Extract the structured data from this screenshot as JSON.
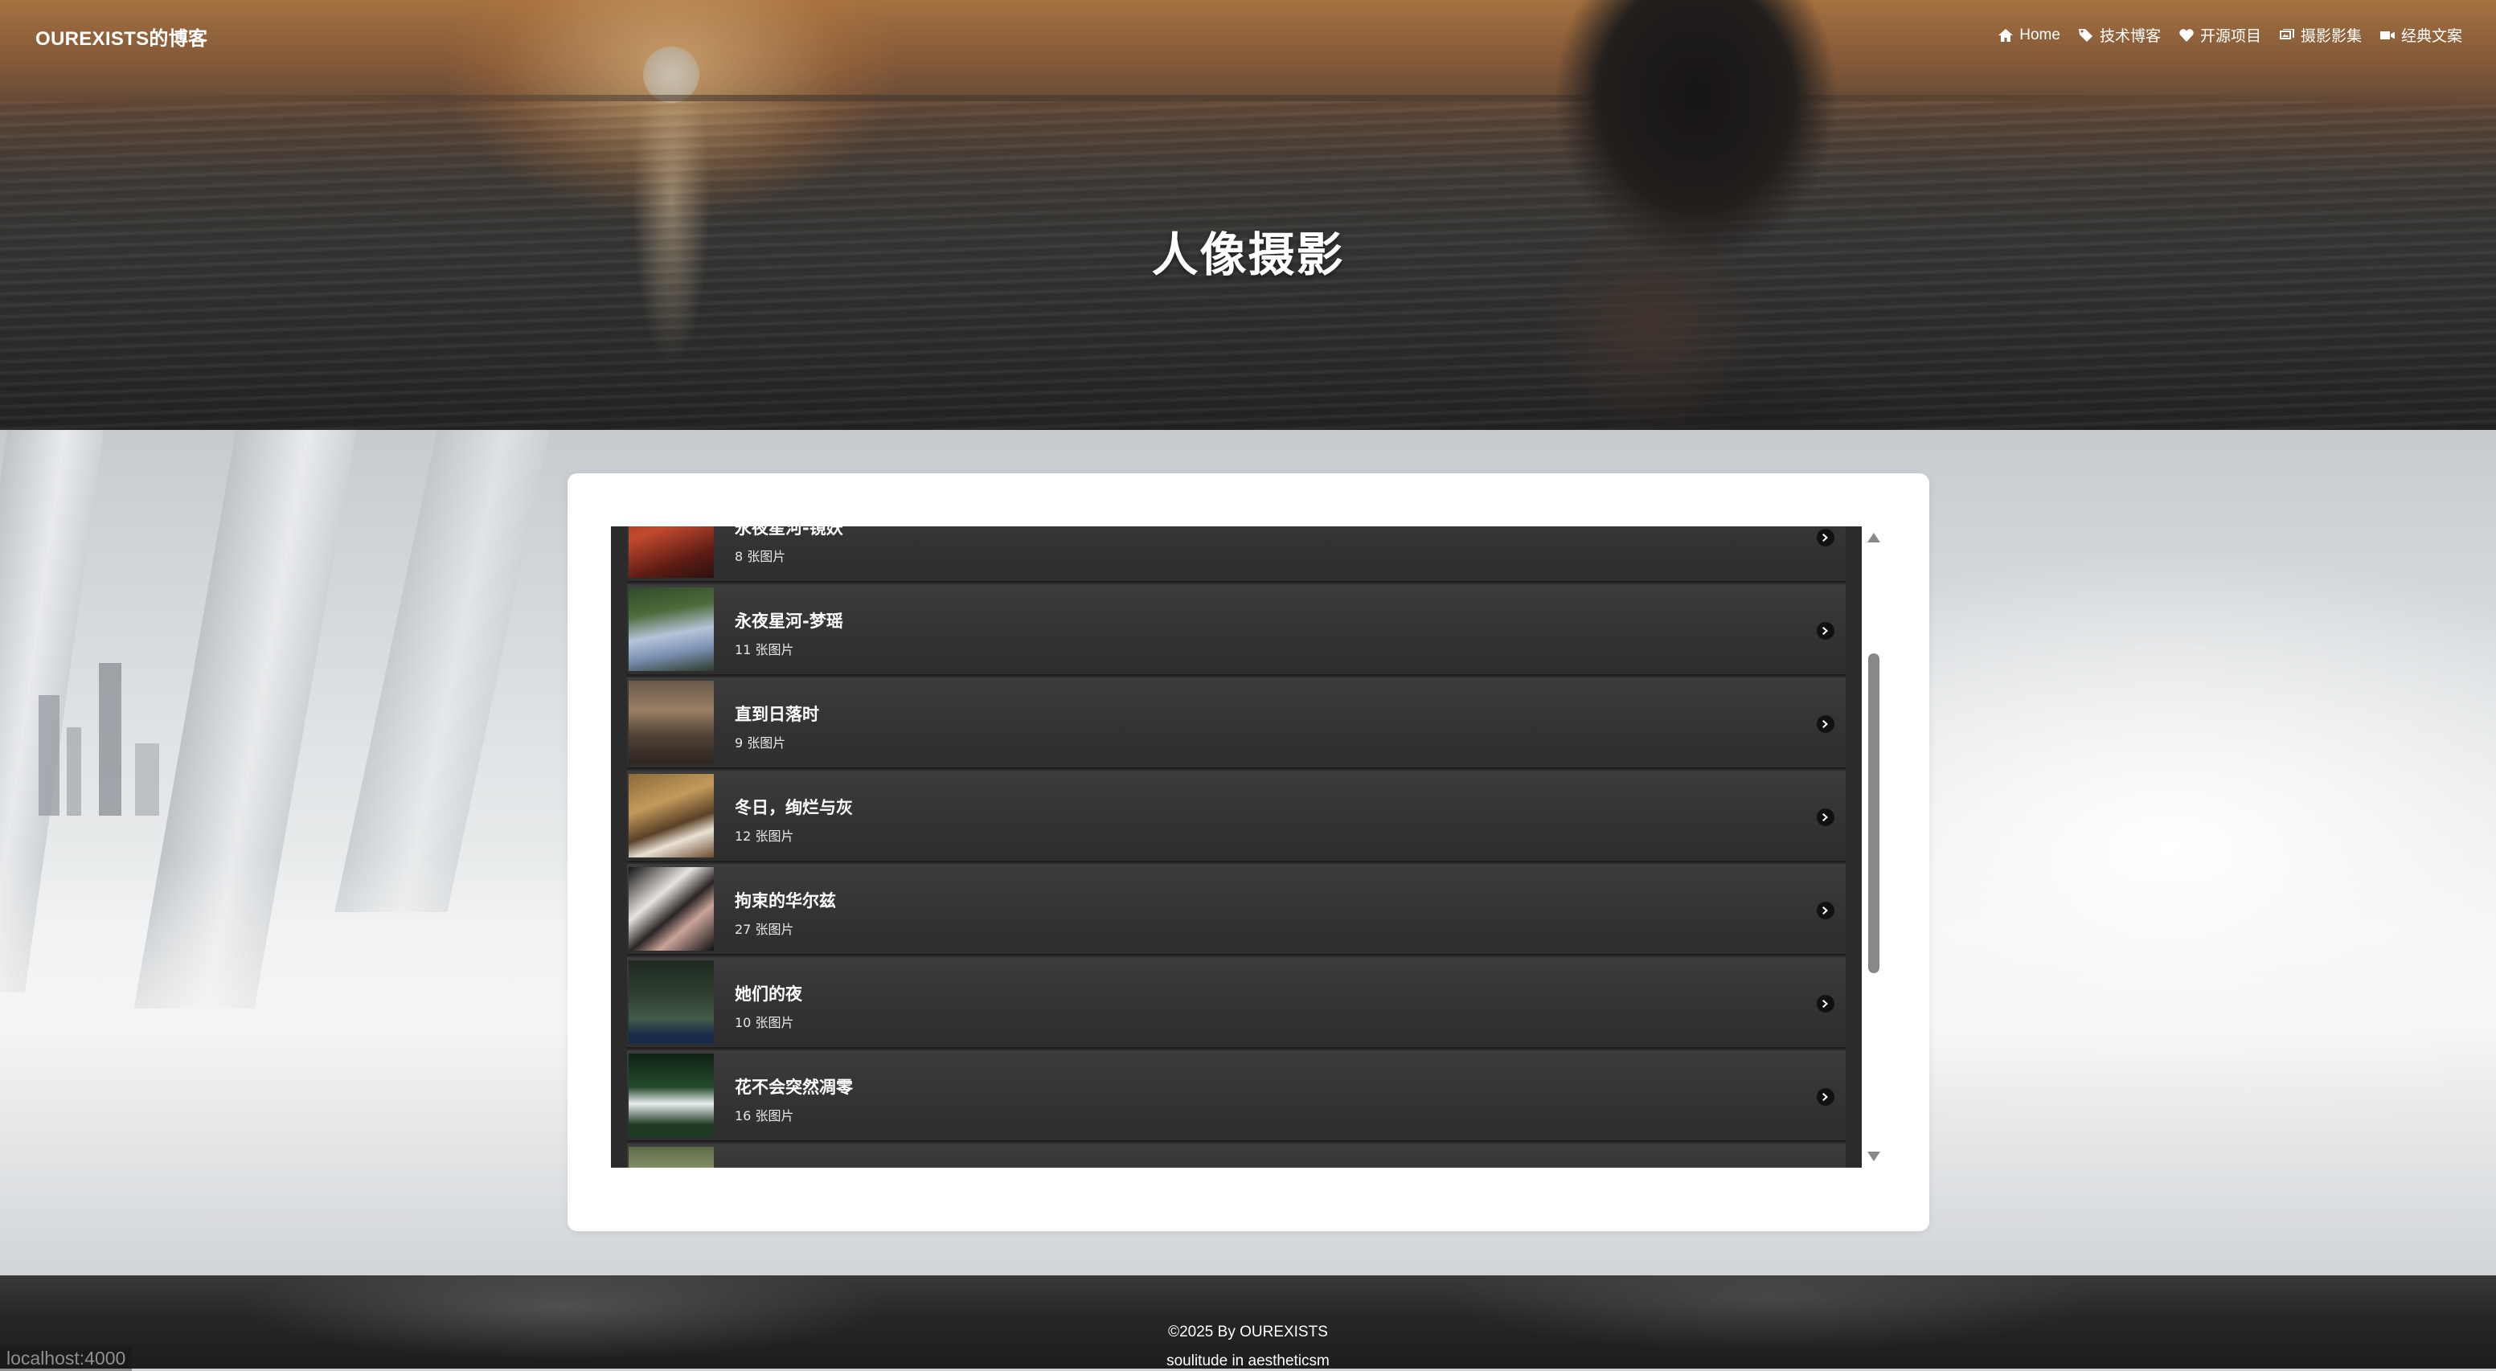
{
  "site": {
    "brand": "OUREXISTS的博客"
  },
  "nav": [
    {
      "label": "Home",
      "icon": "home-icon"
    },
    {
      "label": "技术博客",
      "icon": "tags-icon"
    },
    {
      "label": "开源项目",
      "icon": "heart-icon"
    },
    {
      "label": "摄影影集",
      "icon": "images-icon"
    },
    {
      "label": "经典文案",
      "icon": "video-icon"
    }
  ],
  "hero": {
    "title": "人像摄影"
  },
  "albums": [
    {
      "title": "永夜星河-镜妖",
      "count": "8 张图片"
    },
    {
      "title": "永夜星河-梦瑶",
      "count": "11 张图片"
    },
    {
      "title": "直到日落时",
      "count": "9 张图片"
    },
    {
      "title": "冬日，绚烂与灰",
      "count": "12 张图片"
    },
    {
      "title": "拘束的华尔兹",
      "count": "27 张图片"
    },
    {
      "title": "她们的夜",
      "count": "10 张图片"
    },
    {
      "title": "花不会突然凋零",
      "count": "16 张图片"
    }
  ],
  "footer": {
    "copyright": "©2025 By OUREXISTS",
    "motto": "soulitude in aestheticsm"
  },
  "status": {
    "url": "localhost:4000"
  }
}
